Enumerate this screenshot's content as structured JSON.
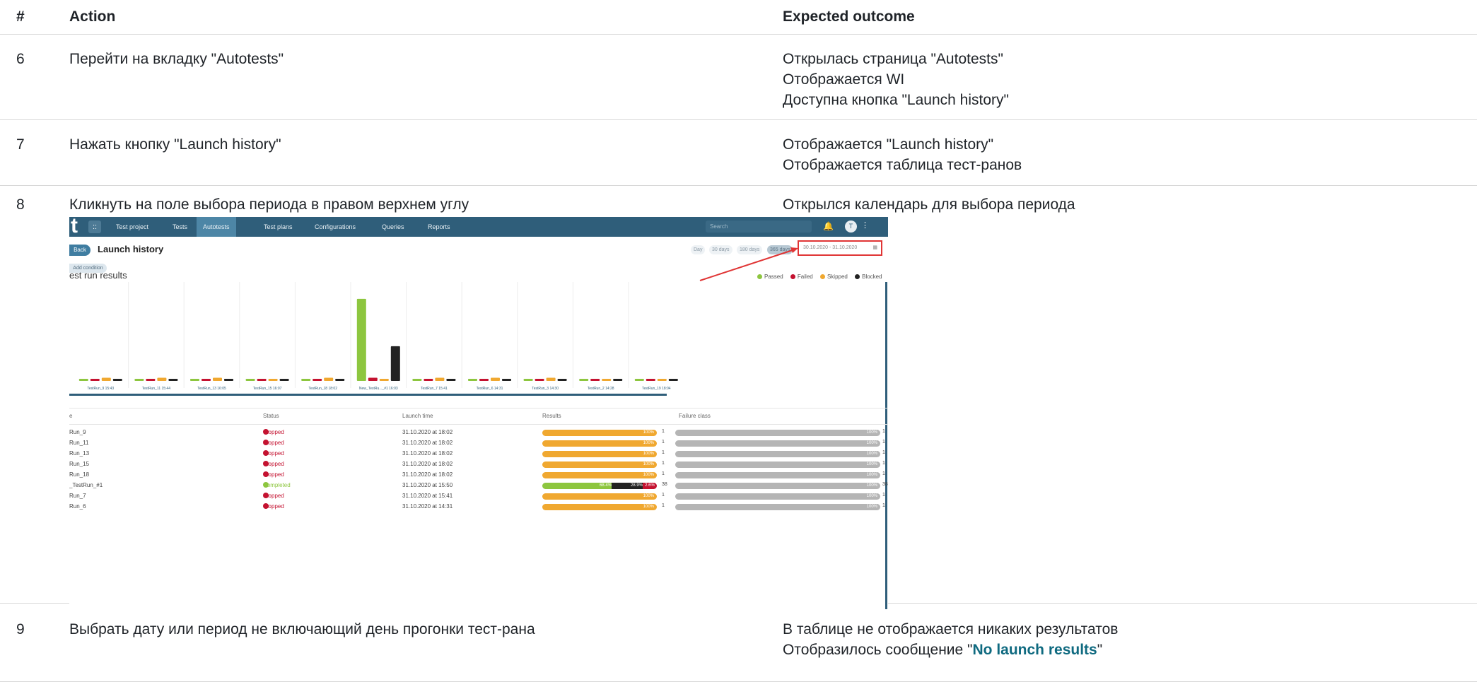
{
  "header": {
    "num": "#",
    "action": "Action",
    "expected": "Expected outcome"
  },
  "steps": [
    {
      "num": "6",
      "action": "Перейти на вкладку \"Autotests\"",
      "expected": [
        "Открылась страница \"Autotests\"",
        "Отображается WI",
        "Доступна кнопка \"Launch history\""
      ]
    },
    {
      "num": "7",
      "action": "Нажать кнопку \"Launch history\"",
      "expected": [
        "Отображается \"Launch history\"",
        "Отображается таблица тест-ранов"
      ]
    },
    {
      "num": "8",
      "action": "Кликнуть на поле выбора периода в правом верхнем углу",
      "expected": [
        "Открылся календарь для выбора периода"
      ]
    },
    {
      "num": "9",
      "action": "Выбрать дату или период не включающий день прогонки тест-рана",
      "expected_line1": "В таблице не отображается никаких результатов",
      "expected_line2_pre": "Отобразилось сообщение \"",
      "expected_line2_hl": "No launch results",
      "expected_line2_post": "\""
    }
  ],
  "screenshot": {
    "logo": "t",
    "grid_icon": "::",
    "nav": [
      "Test project",
      "Tests",
      "Autotests",
      "Test plans",
      "Configurations",
      "Queries",
      "Reports"
    ],
    "nav_active": "Autotests",
    "search_placeholder": "Search",
    "bell_icon": "🔔",
    "avatar": "T",
    "menu_dots": "⋮",
    "back": "Back",
    "title": "Launch history",
    "add_condition": "Add condition",
    "ranges": [
      "Day",
      "30 days",
      "180 days",
      "365 days"
    ],
    "selected_range": "365 days",
    "date_range": "30.10.2020 - 31.10.2020",
    "section_title": "est run results",
    "legend": [
      {
        "label": "Passed",
        "color": "#8dc63f"
      },
      {
        "label": "Failed",
        "color": "#c41230"
      },
      {
        "label": "Skipped",
        "color": "#f0a830"
      },
      {
        "label": "Blocked",
        "color": "#222222"
      }
    ],
    "table_headers": [
      "e",
      "Status",
      "Launch time",
      "Results",
      "Failure class"
    ],
    "rows": [
      {
        "name": "Run_9",
        "status": "Stopped",
        "time": "31.10.2020 at 18:02",
        "pct": "100%",
        "count": "1",
        "fpct": "100%",
        "fcount": "1"
      },
      {
        "name": "Run_11",
        "status": "Stopped",
        "time": "31.10.2020 at 18:02",
        "pct": "100%",
        "count": "1",
        "fpct": "100%",
        "fcount": "1"
      },
      {
        "name": "Run_13",
        "status": "Stopped",
        "time": "31.10.2020 at 18:02",
        "pct": "100%",
        "count": "1",
        "fpct": "100%",
        "fcount": "1"
      },
      {
        "name": "Run_15",
        "status": "Stopped",
        "time": "31.10.2020 at 18:02",
        "pct": "100%",
        "count": "1",
        "fpct": "100%",
        "fcount": "1"
      },
      {
        "name": "Run_18",
        "status": "Stopped",
        "time": "31.10.2020 at 18:02",
        "pct": "100%",
        "count": "1",
        "fpct": "100%",
        "fcount": "1"
      },
      {
        "name": "_TestRun_#1",
        "status": "Completed",
        "time": "31.10.2020 at 15:50",
        "split": [
          "68.4%",
          "28.9%",
          "2.6%"
        ],
        "count": "38",
        "fpct": "100%",
        "fcount": "38"
      },
      {
        "name": "Run_7",
        "status": "Stopped",
        "time": "31.10.2020 at 15:41",
        "pct": "100%",
        "count": "1",
        "fpct": "100%",
        "fcount": "1"
      },
      {
        "name": "Run_6",
        "status": "Stopped",
        "time": "31.10.2020 at 14:31",
        "pct": "100%",
        "count": "1",
        "fpct": "100%",
        "fcount": "1"
      }
    ]
  },
  "chart_data": {
    "type": "bar",
    "title": "",
    "categories": [
      "TestRun_9 15:43",
      "TestRun_11 15:44",
      "TestRun_13 16:05",
      "TestRun_15 16:07",
      "TestRun_18 18:02",
      "New_TestRu..._#1 16:03",
      "TestRun_7 15:41",
      "TestRun_6 14:31",
      "TestRun_3 14:30",
      "TestRun_2 14:28",
      "TestRun_19 18:04"
    ],
    "series": [
      {
        "name": "Passed",
        "values": [
          0,
          0,
          0,
          0,
          0,
          26,
          0,
          0,
          0,
          0,
          0
        ]
      },
      {
        "name": "Failed",
        "values": [
          0,
          0,
          0,
          0,
          0,
          1,
          0,
          0,
          0,
          0,
          0
        ]
      },
      {
        "name": "Skipped",
        "values": [
          1,
          1,
          1,
          0,
          1,
          0,
          1,
          1,
          1,
          0,
          0
        ]
      },
      {
        "name": "Blocked",
        "values": [
          0,
          0,
          0,
          0,
          0,
          11,
          0,
          0,
          0,
          0,
          0
        ]
      }
    ],
    "ylim": [
      0,
      28
    ],
    "legend": "top-right"
  }
}
